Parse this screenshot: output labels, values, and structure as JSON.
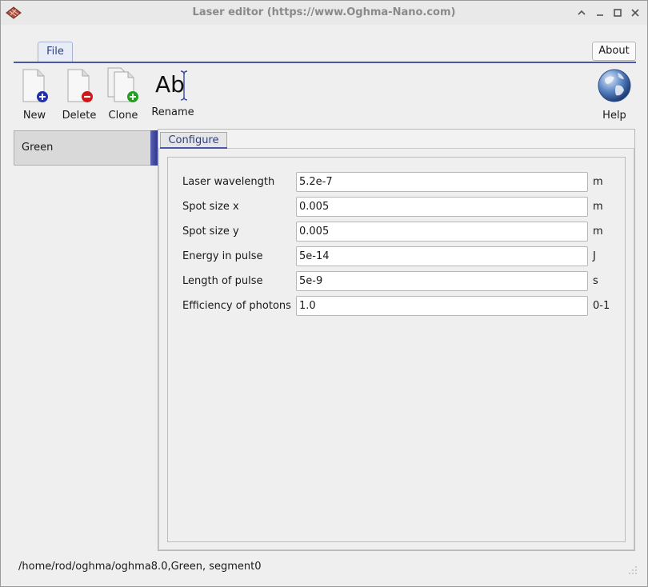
{
  "window": {
    "title": "Laser editor (https://www.Oghma-Nano.com)"
  },
  "menu": {
    "file_tab": "File",
    "about_label": "About"
  },
  "toolbar": {
    "new_label": "New",
    "delete_label": "Delete",
    "clone_label": "Clone",
    "rename_label": "Rename",
    "rename_glyph": "Ab",
    "help_label": "Help"
  },
  "sidebar": {
    "items": [
      {
        "label": "Green"
      }
    ]
  },
  "config": {
    "tab_label": "Configure",
    "rows": [
      {
        "label": "Laser wavelength",
        "value": "5.2e-7",
        "unit": "m"
      },
      {
        "label": "Spot size x",
        "value": "0.005",
        "unit": "m"
      },
      {
        "label": "Spot size y",
        "value": "0.005",
        "unit": "m"
      },
      {
        "label": "Energy in pulse",
        "value": "5e-14",
        "unit": "J"
      },
      {
        "label": "Length of pulse",
        "value": "5e-9",
        "unit": "s"
      },
      {
        "label": "Efficiency of photons",
        "value": "1.0",
        "unit": "0-1"
      }
    ]
  },
  "status": {
    "path": "/home/rod/oghma/oghma8.0,Green, segment0"
  },
  "colors": {
    "accent": "#4c56a6",
    "tab_text": "#2f3f7a"
  }
}
